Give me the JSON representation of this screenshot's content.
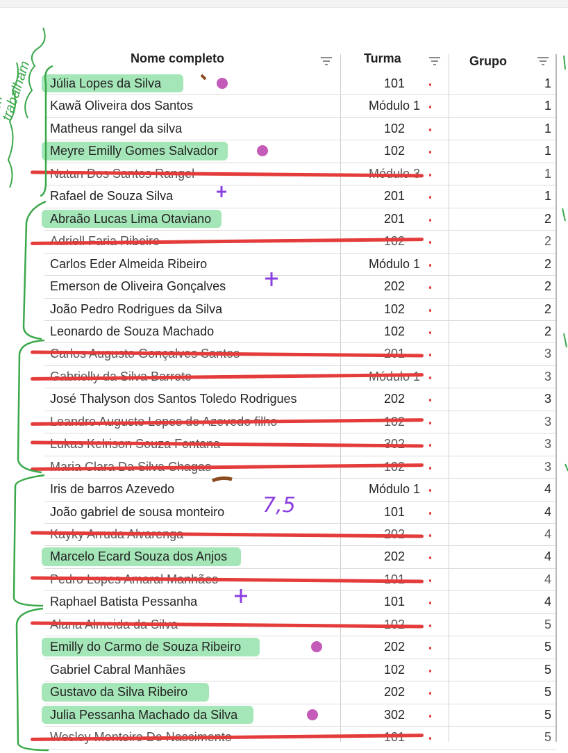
{
  "columns": [
    {
      "label": "Nome completo"
    },
    {
      "label": "Turma"
    },
    {
      "label": "Grupo"
    }
  ],
  "rows": [
    {
      "nome": "Júlia Lopes da Silva",
      "turma": "101",
      "grupo": "1",
      "mark": "highlight"
    },
    {
      "nome": "Kawã Oliveira dos Santos",
      "turma": "Módulo 1",
      "grupo": "1",
      "mark": "none"
    },
    {
      "nome": "Matheus rangel da silva",
      "turma": "102",
      "grupo": "1",
      "mark": "none"
    },
    {
      "nome": "Meyre Emilly Gomes Salvador",
      "turma": "102",
      "grupo": "1",
      "mark": "highlight"
    },
    {
      "nome": "Natan Dos Santos Rangel",
      "turma": "Módulo 3",
      "grupo": "1",
      "mark": "strike"
    },
    {
      "nome": "Rafael de Souza Silva",
      "turma": "201",
      "grupo": "1",
      "mark": "none"
    },
    {
      "nome": "Abraão Lucas Lima Otaviano",
      "turma": "201",
      "grupo": "2",
      "mark": "highlight"
    },
    {
      "nome": "Adriell Faria Ribeiro",
      "turma": "102",
      "grupo": "2",
      "mark": "strike"
    },
    {
      "nome": "Carlos Eder Almeida Ribeiro",
      "turma": "Módulo 1",
      "grupo": "2",
      "mark": "none"
    },
    {
      "nome": "Emerson de Oliveira Gonçalves",
      "turma": "202",
      "grupo": "2",
      "mark": "none"
    },
    {
      "nome": "João Pedro Rodrigues da Silva",
      "turma": "102",
      "grupo": "2",
      "mark": "none"
    },
    {
      "nome": "Leonardo de Souza Machado",
      "turma": "102",
      "grupo": "2",
      "mark": "none"
    },
    {
      "nome": "Carlos Augusto Gonçalves Santos",
      "turma": "201",
      "grupo": "3",
      "mark": "strike"
    },
    {
      "nome": "Gabrielly da Silva Barreto",
      "turma": "Módulo 1",
      "grupo": "3",
      "mark": "strike"
    },
    {
      "nome": "José Thalyson dos Santos Toledo Rodrigues",
      "turma": "202",
      "grupo": "3",
      "mark": "none"
    },
    {
      "nome": "Leandro Augusto Lopes de Azevedo filho",
      "turma": "102",
      "grupo": "3",
      "mark": "strike"
    },
    {
      "nome": "Lukas Kelrison Souza Fontana",
      "turma": "302",
      "grupo": "3",
      "mark": "strike"
    },
    {
      "nome": "Maria Clara Da Silva Chagas",
      "turma": "102",
      "grupo": "3",
      "mark": "strike"
    },
    {
      "nome": "Iris de barros Azevedo",
      "turma": "Módulo 1",
      "grupo": "4",
      "mark": "none"
    },
    {
      "nome": "João gabriel de sousa monteiro",
      "turma": "101",
      "grupo": "4",
      "mark": "none"
    },
    {
      "nome": "Kayky Arruda Alvarenga",
      "turma": "202",
      "grupo": "4",
      "mark": "strike"
    },
    {
      "nome": "Marcelo Ecard Souza dos Anjos",
      "turma": "202",
      "grupo": "4",
      "mark": "highlight"
    },
    {
      "nome": "Pedro Lopes Amaral Manhães",
      "turma": "101",
      "grupo": "4",
      "mark": "strike"
    },
    {
      "nome": "Raphael Batista Pessanha",
      "turma": "101",
      "grupo": "4",
      "mark": "none"
    },
    {
      "nome": "Alana Almeida da Silva",
      "turma": "102",
      "grupo": "5",
      "mark": "strike"
    },
    {
      "nome": "Emilly do Carmo de Souza Ribeiro",
      "turma": "202",
      "grupo": "5",
      "mark": "highlight"
    },
    {
      "nome": "Gabriel Cabral Manhães",
      "turma": "102",
      "grupo": "5",
      "mark": "none"
    },
    {
      "nome": "Gustavo da Silva Ribeiro",
      "turma": "202",
      "grupo": "5",
      "mark": "highlight"
    },
    {
      "nome": "Julia Pessanha Machado da Silva",
      "turma": "302",
      "grupo": "5",
      "mark": "highlight"
    },
    {
      "nome": "Wesley Monteiro De Nascimento",
      "turma": "101",
      "grupo": "5",
      "mark": "strike"
    }
  ],
  "annotations": {
    "handwritten_score": "7,5",
    "margin_note_1": "mofim",
    "margin_note_2": "trabalham"
  },
  "colors": {
    "highlight": "#7fdc9a",
    "strike": "#e43b3b",
    "bracket": "#3aa84a",
    "purple_mark": "#8a3fe0",
    "pink_mark": "#c45bb8"
  }
}
